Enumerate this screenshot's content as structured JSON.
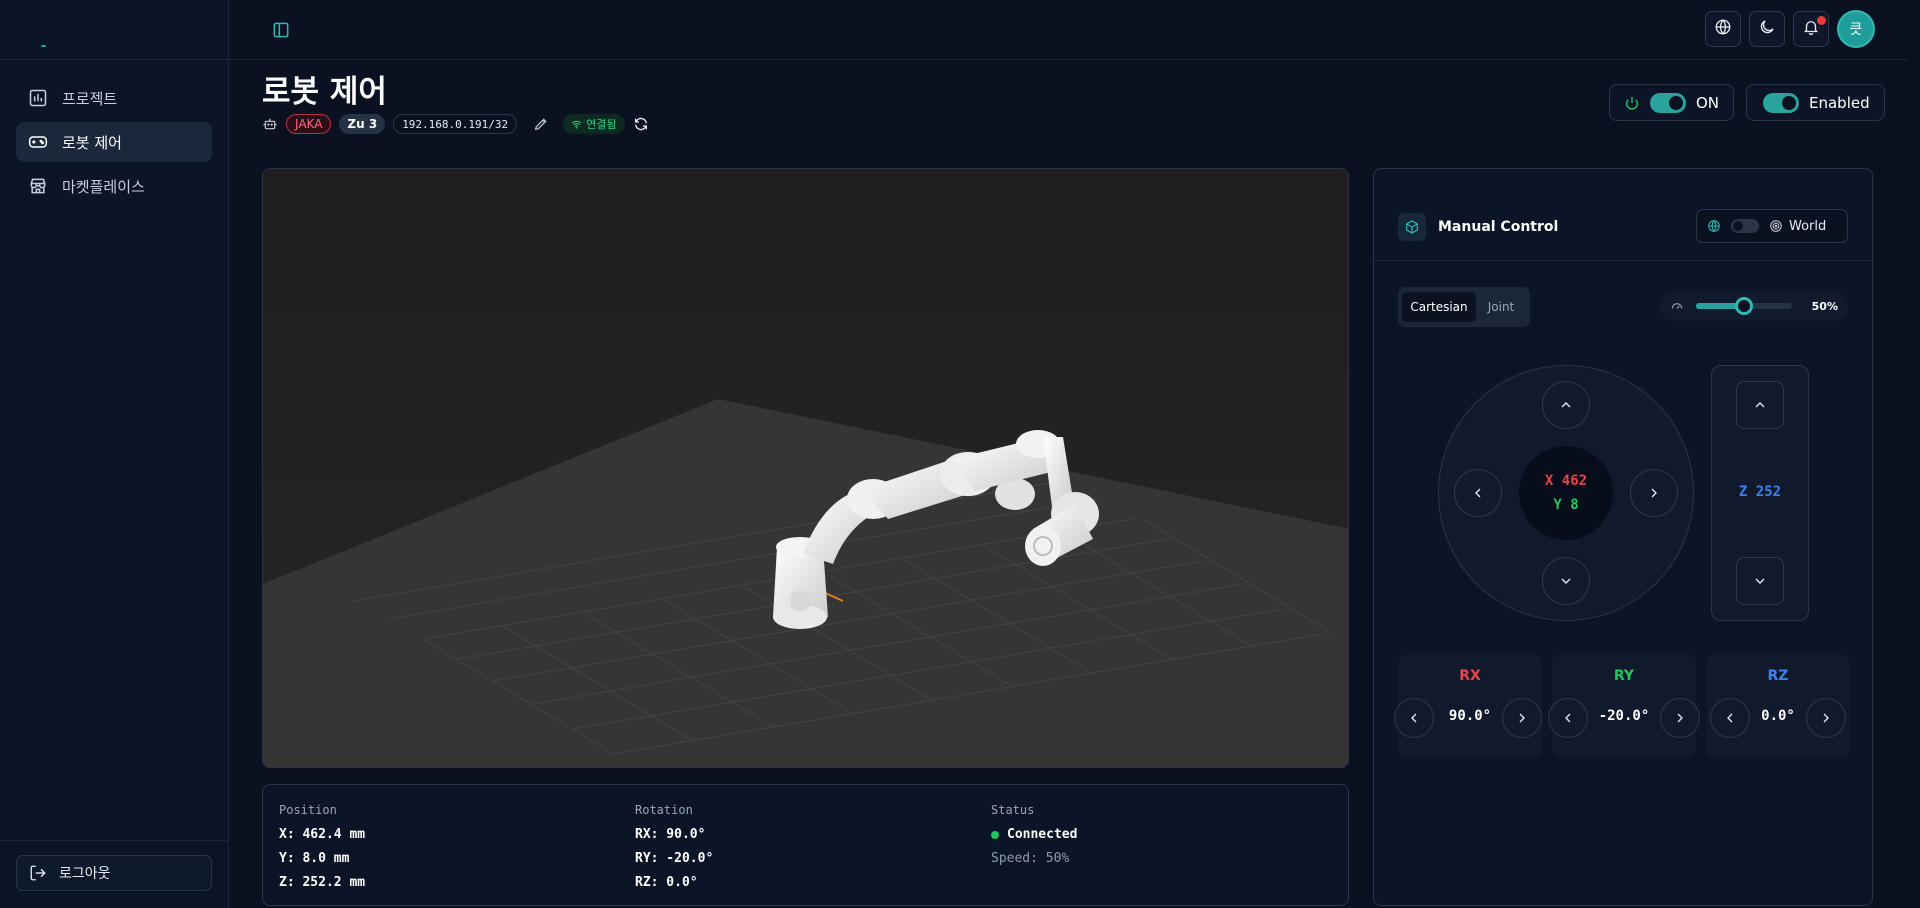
{
  "sidebar": {
    "items": [
      {
        "label": "프로젝트",
        "icon": "project-chart-icon"
      },
      {
        "label": "로봇 제어",
        "icon": "gamepad-icon"
      },
      {
        "label": "마켓플레이스",
        "icon": "store-icon"
      }
    ],
    "logout_label": "로그아웃"
  },
  "topbar": {
    "avatar_initial": "큿"
  },
  "page": {
    "title": "로봇 제어",
    "brand": "JAKA",
    "model": "Zu 3",
    "ip": "192.168.0.191/32",
    "connection": "연결됨",
    "power_label": "ON",
    "enabled_label": "Enabled"
  },
  "info": {
    "position_title": "Position",
    "x": "X: 462.4 mm",
    "y": "Y: 8.0 mm",
    "z": "Z: 252.2 mm",
    "rotation_title": "Rotation",
    "rx": "RX: 90.0°",
    "ry": "RY: -20.0°",
    "rz": "RZ: 0.0°",
    "status_title": "Status",
    "status": "Connected",
    "speed": "Speed: 50%"
  },
  "panel": {
    "title": "Manual Control",
    "frame_label": "World",
    "mode_tabs": [
      "Cartesian",
      "Joint"
    ],
    "active_mode": "Cartesian",
    "speed_label": "50%",
    "speed_fraction": 0.5,
    "joy_x": "X 462",
    "joy_y": "Y 8",
    "z_label": "Z 252",
    "rotations": [
      {
        "label": "RX",
        "value": "90.0°",
        "color": "#ef4444"
      },
      {
        "label": "RY",
        "value": "-20.0°",
        "color": "#22c55e"
      },
      {
        "label": "RZ",
        "value": "0.0°",
        "color": "#3b82f6"
      }
    ]
  },
  "colors": {
    "accent": "#2aa39f",
    "x_color": "#ef4444",
    "y_color": "#22c55e",
    "z_color": "#3b82f6",
    "status_ok": "#22c55e"
  }
}
